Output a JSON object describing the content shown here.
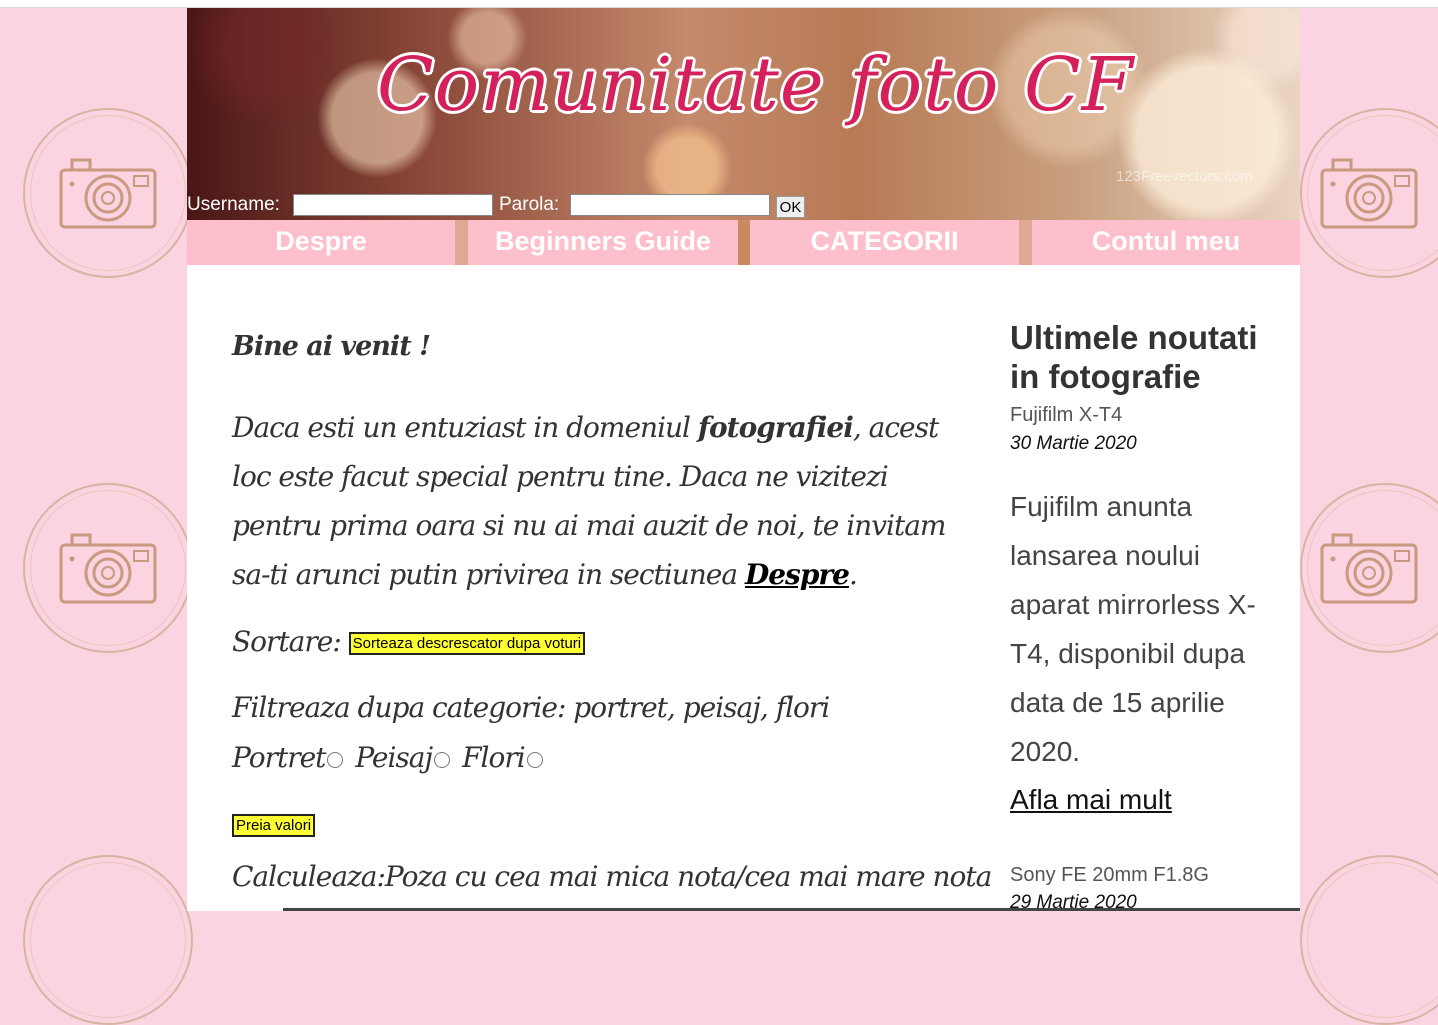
{
  "header": {
    "site_title": "Comunitate foto CF",
    "watermark": "123Freevectors.com"
  },
  "login": {
    "username_label": "Username:",
    "password_label": "Parola:",
    "username_value": "",
    "password_value": "",
    "ok_label": "OK"
  },
  "nav": {
    "items": [
      {
        "label": "Despre"
      },
      {
        "label": "Beginners Guide"
      },
      {
        "label": "CATEGORII"
      },
      {
        "label": "Contul meu"
      }
    ]
  },
  "main": {
    "welcome": "Bine ai venit !",
    "intro_part1": "Daca esti un entuziast in domeniul ",
    "intro_bold": "fotografiei",
    "intro_part2": ", acest loc este facut special pentru tine. Daca ne vizitezi pentru prima oara si nu ai mai auzit de noi, te invitam sa-ti arunci putin privirea in sectiunea ",
    "intro_link": "Despre",
    "intro_end": ".",
    "sort_label": "Sortare:",
    "sort_button": "Sorteaza descrescator dupa voturi",
    "filter_label": "Filtreaza dupa categorie: portret, peisaj, flori",
    "radio_labels": [
      "Portret",
      "Peisaj",
      "Flori"
    ],
    "apply_button": "Preia valori",
    "calculate_label": "Calculeaza:Poza cu cea mai mica nota/cea mai mare nota"
  },
  "sidebar": {
    "title": "Ultimele noutati in fotografie",
    "news": [
      {
        "title": "Fujifilm X-T4",
        "date": "30 Martie 2020",
        "body": "Fujifilm anunta lansarea noului aparat mirrorless X-T4, disponibil dupa data de 15 aprilie 2020.",
        "link": "Afla mai mult"
      },
      {
        "title": "Sony FE 20mm F1.8G",
        "date": "29 Martie 2020"
      }
    ]
  },
  "colors": {
    "page_background": "#fcd3e0",
    "nav_item": "#fdbfcb",
    "title_pink": "#d4215b",
    "button_yellow": "#ffff33"
  }
}
